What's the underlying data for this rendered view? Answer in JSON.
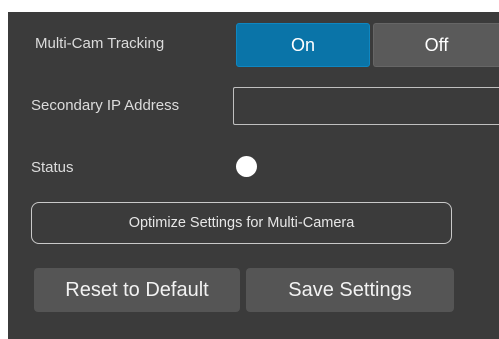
{
  "multicam": {
    "label": "Multi-Cam Tracking",
    "on_label": "On",
    "off_label": "Off",
    "selected": "On"
  },
  "secondary_ip": {
    "label": "Secondary IP Address",
    "value": "",
    "placeholder": ""
  },
  "status": {
    "label": "Status",
    "indicator_color": "#ffffff"
  },
  "optimize": {
    "label": "Optimize Settings for Multi-Camera"
  },
  "actions": {
    "reset_label": "Reset to Default",
    "save_label": "Save Settings"
  },
  "colors": {
    "accent": "#0a74a8",
    "panel": "#3b3b3b",
    "button": "#555555"
  }
}
